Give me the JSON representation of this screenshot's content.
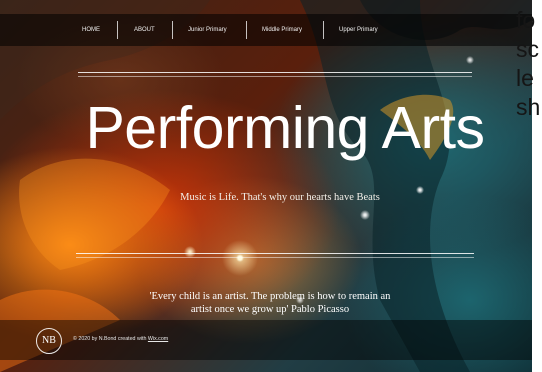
{
  "nav": {
    "items": [
      {
        "label": "HOME"
      },
      {
        "label": "ABOUT"
      },
      {
        "label": "Junior Primary"
      },
      {
        "label": "Middle Primary"
      },
      {
        "label": "Upper Primary"
      }
    ]
  },
  "hero": {
    "title": "Performing Arts",
    "tagline": "Music is Life. That's why our hearts have Beats",
    "quote": "'Every child is an artist. The problem is how to remain an artist once we grow up'   Pablo Picasso"
  },
  "footer": {
    "logo_text": "NB",
    "copyright_prefix": "© 2020 by N.Bond created with",
    "copyright_link": "Wix.com"
  },
  "side_text": {
    "lines": [
      "fo",
      "sc",
      "le",
      "sh"
    ]
  }
}
